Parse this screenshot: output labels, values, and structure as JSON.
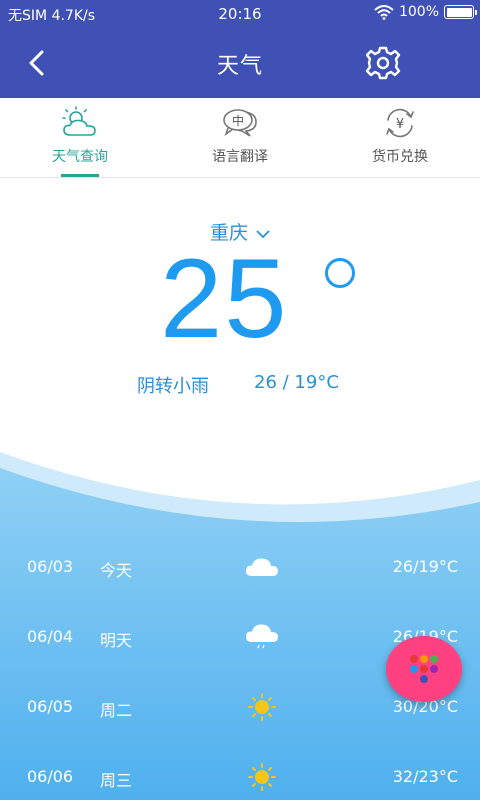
{
  "status": {
    "carrier": "无SIM",
    "speed": "4.7K/s",
    "time": "20:16",
    "battery": "100%"
  },
  "appbar": {
    "title": "天气"
  },
  "tabs": [
    {
      "label": "天气查询",
      "icon": "weather-icon",
      "active": true
    },
    {
      "label": "语言翻译",
      "icon": "translate-icon",
      "active": false
    },
    {
      "label": "货币兑换",
      "icon": "currency-icon",
      "active": false
    }
  ],
  "current": {
    "city": "重庆",
    "temp": "25",
    "condition": "阴转小雨",
    "range": "26 / 19°C"
  },
  "forecast": [
    {
      "date": "06/03",
      "day": "今天",
      "icon": "cloud-icon",
      "temp": "26/19°C"
    },
    {
      "date": "06/04",
      "day": "明天",
      "icon": "rain-cloud-icon",
      "temp": "26/19°C"
    },
    {
      "date": "06/05",
      "day": "周二",
      "icon": "sun-icon",
      "temp": "30/20°C"
    },
    {
      "date": "06/06",
      "day": "周三",
      "icon": "sun-icon",
      "temp": "32/23°C"
    }
  ],
  "colors": {
    "primary": "#3f51b5",
    "accent": "#26a69a",
    "temp": "#1e9bf0",
    "fab": "#ff4081"
  }
}
